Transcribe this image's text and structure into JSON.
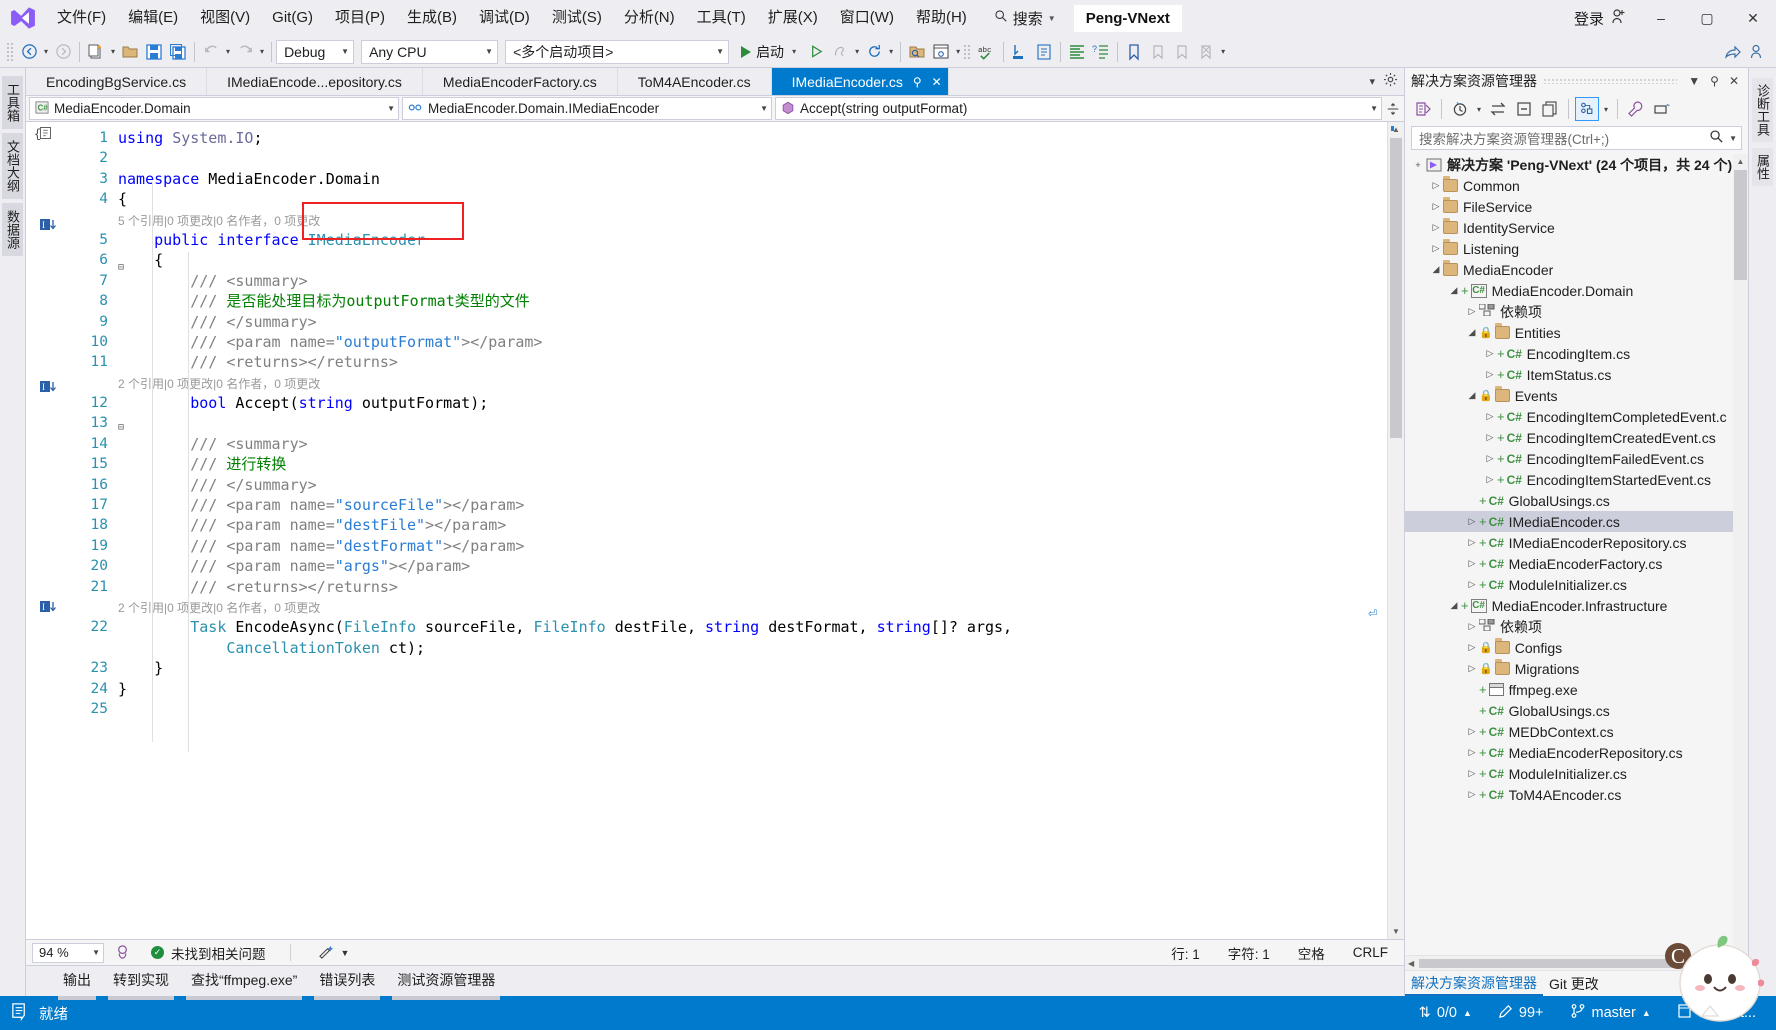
{
  "titlebar": {
    "menus": [
      "文件(F)",
      "编辑(E)",
      "视图(V)",
      "Git(G)",
      "项目(P)",
      "生成(B)",
      "调试(D)",
      "测试(S)",
      "分析(N)",
      "工具(T)",
      "扩展(X)",
      "窗口(W)",
      "帮助(H)"
    ],
    "search_label": "搜索",
    "project_badge": "Peng-VNext",
    "signin_label": "登录",
    "minimize": "–",
    "maximize": "▢",
    "close": "✕"
  },
  "toolbar": {
    "config": "Debug",
    "platform": "Any CPU",
    "startup_project": "<多个启动项目>",
    "start_label": "启动"
  },
  "leftdock": {
    "tabs": [
      "工具箱",
      "文档大纲",
      "数据源"
    ]
  },
  "rightdock": {
    "tabs": [
      "诊断工具",
      "属性"
    ]
  },
  "editor": {
    "tabs": [
      {
        "label": "EncodingBgService.cs",
        "active": false
      },
      {
        "label": "IMediaEncode...epository.cs",
        "active": false
      },
      {
        "label": "MediaEncoderFactory.cs",
        "active": false
      },
      {
        "label": "ToM4AEncoder.cs",
        "active": false
      },
      {
        "label": "IMediaEncoder.cs",
        "active": true
      }
    ],
    "nav": {
      "project": "MediaEncoder.Domain",
      "type": "MediaEncoder.Domain.IMediaEncoder",
      "member": "Accept(string outputFormat)"
    },
    "lines": [
      {
        "n": 1,
        "text": "using System.IO;"
      },
      {
        "n": 2,
        "text": ""
      },
      {
        "n": 3,
        "text": "namespace MediaEncoder.Domain"
      },
      {
        "n": 4,
        "text": "{"
      },
      {
        "n": 5,
        "text": "    public interface IMediaEncoder"
      },
      {
        "n": 6,
        "text": "    {"
      },
      {
        "n": 7,
        "text": "        /// <summary>"
      },
      {
        "n": 8,
        "text": "        /// 是否能处理目标为outputFormat类型的文件"
      },
      {
        "n": 9,
        "text": "        /// </summary>"
      },
      {
        "n": 10,
        "text": "        /// <param name=\"outputFormat\"></param>"
      },
      {
        "n": 11,
        "text": "        /// <returns></returns>"
      },
      {
        "n": 12,
        "text": "        bool Accept(string outputFormat);"
      },
      {
        "n": 13,
        "text": ""
      },
      {
        "n": 14,
        "text": "        /// <summary>"
      },
      {
        "n": 15,
        "text": "        /// 进行转换"
      },
      {
        "n": 16,
        "text": "        /// </summary>"
      },
      {
        "n": 17,
        "text": "        /// <param name=\"sourceFile\"></param>"
      },
      {
        "n": 18,
        "text": "        /// <param name=\"destFile\"></param>"
      },
      {
        "n": 19,
        "text": "        /// <param name=\"destFormat\"></param>"
      },
      {
        "n": 20,
        "text": "        /// <param name=\"args\"></param>"
      },
      {
        "n": 21,
        "text": "        /// <returns></returns>"
      },
      {
        "n": 22,
        "text": "        Task EncodeAsync(FileInfo sourceFile, FileInfo destFile, string destFormat, string[]? args,"
      },
      {
        "n": 23,
        "text": "    }"
      },
      {
        "n": 24,
        "text": "}"
      },
      {
        "n": 25,
        "text": ""
      }
    ],
    "codelens": {
      "interface": "5 个引用|0 项更改|0 名作者，0 项更改",
      "accept": "2 个引用|0 项更改|0 名作者，0 项更改",
      "encode": "2 个引用|0 项更改|0 名作者，0 项更改"
    },
    "continuation": "CancellationToken ct);",
    "status": {
      "zoom": "94 %",
      "issues": "未找到相关问题",
      "line": "行: 1",
      "col": "字符: 1",
      "indent": "空格",
      "eol": "CRLF"
    }
  },
  "bottom_tool_tabs": [
    "输出",
    "转到实现",
    "查找“ffmpeg.exe”",
    "错误列表",
    "测试资源管理器"
  ],
  "solution_explorer": {
    "title": "解决方案资源管理器",
    "search_placeholder": "搜索解决方案资源管理器(Ctrl+;)",
    "tabs": [
      {
        "label": "解决方案资源管理器",
        "active": true
      },
      {
        "label": "Git 更改",
        "active": false
      }
    ],
    "tree": [
      {
        "indent": 0,
        "exp": "+",
        "icon": "solution",
        "label": "解决方案 'Peng-VNext' (24 个项目，共 24 个)",
        "bold": true,
        "sel": false
      },
      {
        "indent": 1,
        "exp": "▷",
        "icon": "folder",
        "label": "Common",
        "bold": false,
        "sel": false
      },
      {
        "indent": 1,
        "exp": "▷",
        "icon": "folder",
        "label": "FileService",
        "bold": false,
        "sel": false
      },
      {
        "indent": 1,
        "exp": "▷",
        "icon": "folder",
        "label": "IdentityService",
        "bold": false,
        "sel": false
      },
      {
        "indent": 1,
        "exp": "▷",
        "icon": "folder",
        "label": "Listening",
        "bold": false,
        "sel": false
      },
      {
        "indent": 1,
        "exp": "◢",
        "icon": "folder",
        "label": "MediaEncoder",
        "bold": false,
        "sel": false
      },
      {
        "indent": 2,
        "exp": "◢",
        "icon": "csproj",
        "label": "MediaEncoder.Domain",
        "bold": false,
        "sel": false,
        "plus": true
      },
      {
        "indent": 3,
        "exp": "▷",
        "icon": "dep",
        "label": "依赖项",
        "bold": false,
        "sel": false
      },
      {
        "indent": 3,
        "exp": "◢",
        "icon": "folder",
        "label": "Entities",
        "bold": false,
        "sel": false,
        "lock": true
      },
      {
        "indent": 4,
        "exp": "▷",
        "icon": "cs",
        "label": "EncodingItem.cs",
        "bold": false,
        "sel": false,
        "plus": true
      },
      {
        "indent": 4,
        "exp": "▷",
        "icon": "cs",
        "label": "ItemStatus.cs",
        "bold": false,
        "sel": false,
        "plus": true
      },
      {
        "indent": 3,
        "exp": "◢",
        "icon": "folder",
        "label": "Events",
        "bold": false,
        "sel": false,
        "lock": true
      },
      {
        "indent": 4,
        "exp": "▷",
        "icon": "cs",
        "label": "EncodingItemCompletedEvent.c",
        "bold": false,
        "sel": false,
        "plus": true
      },
      {
        "indent": 4,
        "exp": "▷",
        "icon": "cs",
        "label": "EncodingItemCreatedEvent.cs",
        "bold": false,
        "sel": false,
        "plus": true
      },
      {
        "indent": 4,
        "exp": "▷",
        "icon": "cs",
        "label": "EncodingItemFailedEvent.cs",
        "bold": false,
        "sel": false,
        "plus": true
      },
      {
        "indent": 4,
        "exp": "▷",
        "icon": "cs",
        "label": "EncodingItemStartedEvent.cs",
        "bold": false,
        "sel": false,
        "plus": true
      },
      {
        "indent": 3,
        "exp": "",
        "icon": "cs",
        "label": "GlobalUsings.cs",
        "bold": false,
        "sel": false,
        "plus": true
      },
      {
        "indent": 3,
        "exp": "▷",
        "icon": "cs",
        "label": "IMediaEncoder.cs",
        "bold": false,
        "sel": true,
        "plus": true
      },
      {
        "indent": 3,
        "exp": "▷",
        "icon": "cs",
        "label": "IMediaEncoderRepository.cs",
        "bold": false,
        "sel": false,
        "plus": true
      },
      {
        "indent": 3,
        "exp": "▷",
        "icon": "cs",
        "label": "MediaEncoderFactory.cs",
        "bold": false,
        "sel": false,
        "plus": true
      },
      {
        "indent": 3,
        "exp": "▷",
        "icon": "cs",
        "label": "ModuleInitializer.cs",
        "bold": false,
        "sel": false,
        "plus": true
      },
      {
        "indent": 2,
        "exp": "◢",
        "icon": "csproj",
        "label": "MediaEncoder.Infrastructure",
        "bold": false,
        "sel": false,
        "plus": true
      },
      {
        "indent": 3,
        "exp": "▷",
        "icon": "dep",
        "label": "依赖项",
        "bold": false,
        "sel": false
      },
      {
        "indent": 3,
        "exp": "▷",
        "icon": "folder",
        "label": "Configs",
        "bold": false,
        "sel": false,
        "lock": true
      },
      {
        "indent": 3,
        "exp": "▷",
        "icon": "folder",
        "label": "Migrations",
        "bold": false,
        "sel": false,
        "lock": true
      },
      {
        "indent": 3,
        "exp": "",
        "icon": "exe",
        "label": "ffmpeg.exe",
        "bold": false,
        "sel": false,
        "plus": true
      },
      {
        "indent": 3,
        "exp": "",
        "icon": "cs",
        "label": "GlobalUsings.cs",
        "bold": false,
        "sel": false,
        "plus": true
      },
      {
        "indent": 3,
        "exp": "▷",
        "icon": "cs",
        "label": "MEDbContext.cs",
        "bold": false,
        "sel": false,
        "plus": true
      },
      {
        "indent": 3,
        "exp": "▷",
        "icon": "cs",
        "label": "MediaEncoderRepository.cs",
        "bold": false,
        "sel": false,
        "plus": true
      },
      {
        "indent": 3,
        "exp": "▷",
        "icon": "cs",
        "label": "ModuleInitializer.cs",
        "bold": false,
        "sel": false,
        "plus": true
      },
      {
        "indent": 3,
        "exp": "▷",
        "icon": "cs",
        "label": "ToM4AEncoder.cs",
        "bold": false,
        "sel": false,
        "plus": true
      }
    ]
  },
  "statusbar": {
    "ready": "就绪",
    "sync": "0/0",
    "pending": "99+",
    "branch": "master",
    "repo": "net-not..."
  },
  "colors": {
    "accent": "#007acc",
    "chrome": "#eeeef2",
    "border": "#cccedb",
    "keyword": "#0000ff",
    "type": "#2b91af",
    "string": "#a31515",
    "comment": "#808080",
    "doc_text": "#008000",
    "highlight_box": "#ee2222",
    "folder": "#dcb67a",
    "cs_green": "#3d9140"
  }
}
